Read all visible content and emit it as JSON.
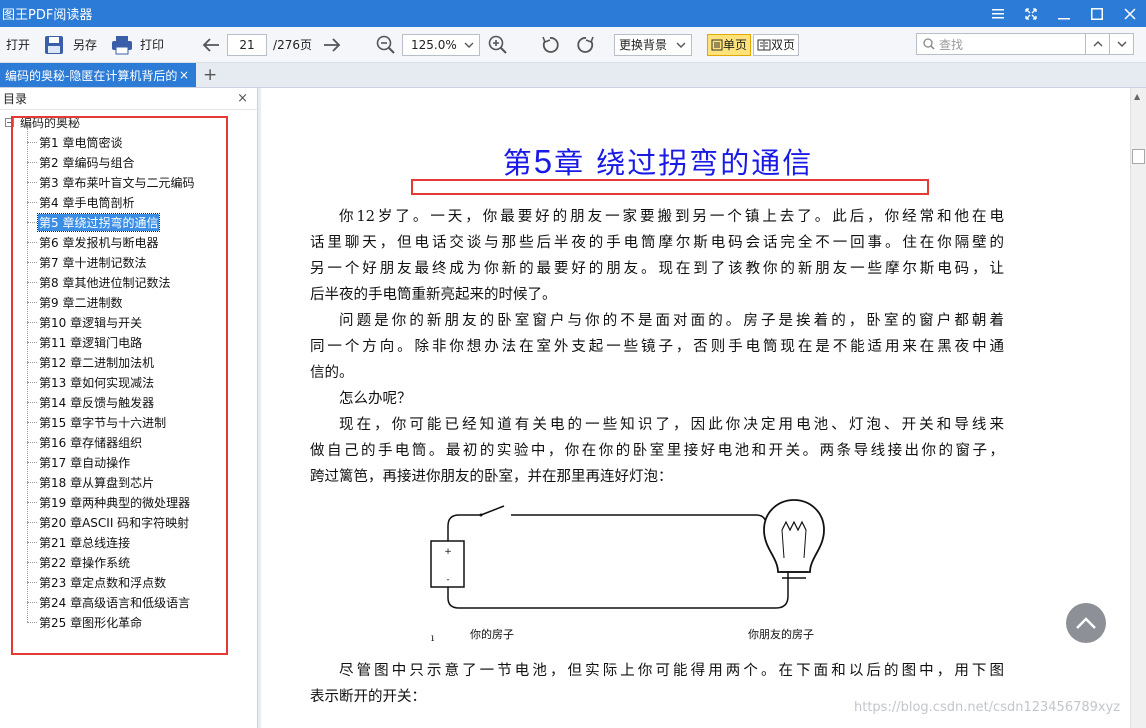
{
  "app": {
    "title": "图王PDF阅读器"
  },
  "toolbar": {
    "open_label": "打开",
    "save_label": "另存",
    "print_label": "打印",
    "page_current": "21",
    "page_total": "/276页",
    "zoom": "125.0%",
    "background_label": "更换背景",
    "single_page_label": "单页",
    "double_page_label": "双页",
    "search_placeholder": "查找"
  },
  "tab": {
    "label": "编码的奥秘-隐匿在计算机背后的",
    "close": "×",
    "add": "+"
  },
  "sidebar": {
    "title": "目录",
    "close": "×",
    "root": "编码的奥秘",
    "items": [
      "第1 章电筒密谈",
      "第2 章编码与组合",
      "第3 章布莱叶盲文与二元编码",
      "第4 章手电筒剖析",
      "第5 章绕过拐弯的通信",
      "第6 章发报机与断电器",
      "第7 章十进制记数法",
      "第8 章其他进位制记数法",
      "第9 章二进制数",
      "第10 章逻辑与开关",
      "第11 章逻辑门电路",
      "第12 章二进制加法机",
      "第13 章如何实现减法",
      "第14 章反馈与触发器",
      "第15 章字节与十六进制",
      "第16 章存储器组织",
      "第17 章自动操作",
      "第18 章从算盘到芯片",
      "第19 章两种典型的微处理器",
      "第20 章ASCII 码和字符映射",
      "第21 章总线连接",
      "第22 章操作系统",
      "第23 章定点数和浮点数",
      "第24 章高级语言和低级语言",
      "第25 章图形化革命"
    ],
    "active_index": 4
  },
  "document": {
    "chapter_prefix": "第",
    "chapter_number": "5",
    "chapter_title": "章 绕过拐弯的通信",
    "p1_lines": [
      "你12岁了。一天，你最要好的朋友一家要搬到另一个镇上去了。此后，你经常和他在电",
      "话里聊天，但电话交谈与那些后半夜的手电筒摩尔斯电码会话完全不一回事。住在你隔壁的",
      "另一个好朋友最终成为你新的最要好的朋友。现在到了该教你的新朋友一些摩尔斯电码，让",
      "后半夜的手电筒重新亮起来的时候了。"
    ],
    "p2_lines": [
      "问题是你的新朋友的卧室窗户与你的不是面对面的。房子是挨着的，卧室的窗户都朝着",
      "同一个方向。除非你想办法在室外支起一些镜子，否则手电筒现在是不能适用来在黑夜中通",
      "信的。"
    ],
    "p3": "怎么办呢？",
    "p4_lines": [
      "现在，你可能已经知道有关电的一些知识了，因此你决定用电池、灯泡、开关和导线来",
      "做自己的手电筒。最初的实验中，你在你的卧室里接好电池和开关。两条导线接出你的窗子，",
      "跨过篱笆，再接进你朋友的卧室，并在那里再连好灯泡："
    ],
    "fig_left": "你的房子",
    "fig_right": "你朋友的房子",
    "p5_lines": [
      "尽管图中只示意了一节电池，但实际上你可能得用两个。在下面和以后的图中，用下图",
      "表示断开的开关："
    ]
  },
  "watermark": "https://blog.csdn.net/csdn123456789xyz",
  "colors": {
    "titlebar": "#2b7bd7",
    "chapter_title": "#1a1ae6",
    "highlight_box": "#e53935",
    "active_toc": "#3a8ee6"
  }
}
